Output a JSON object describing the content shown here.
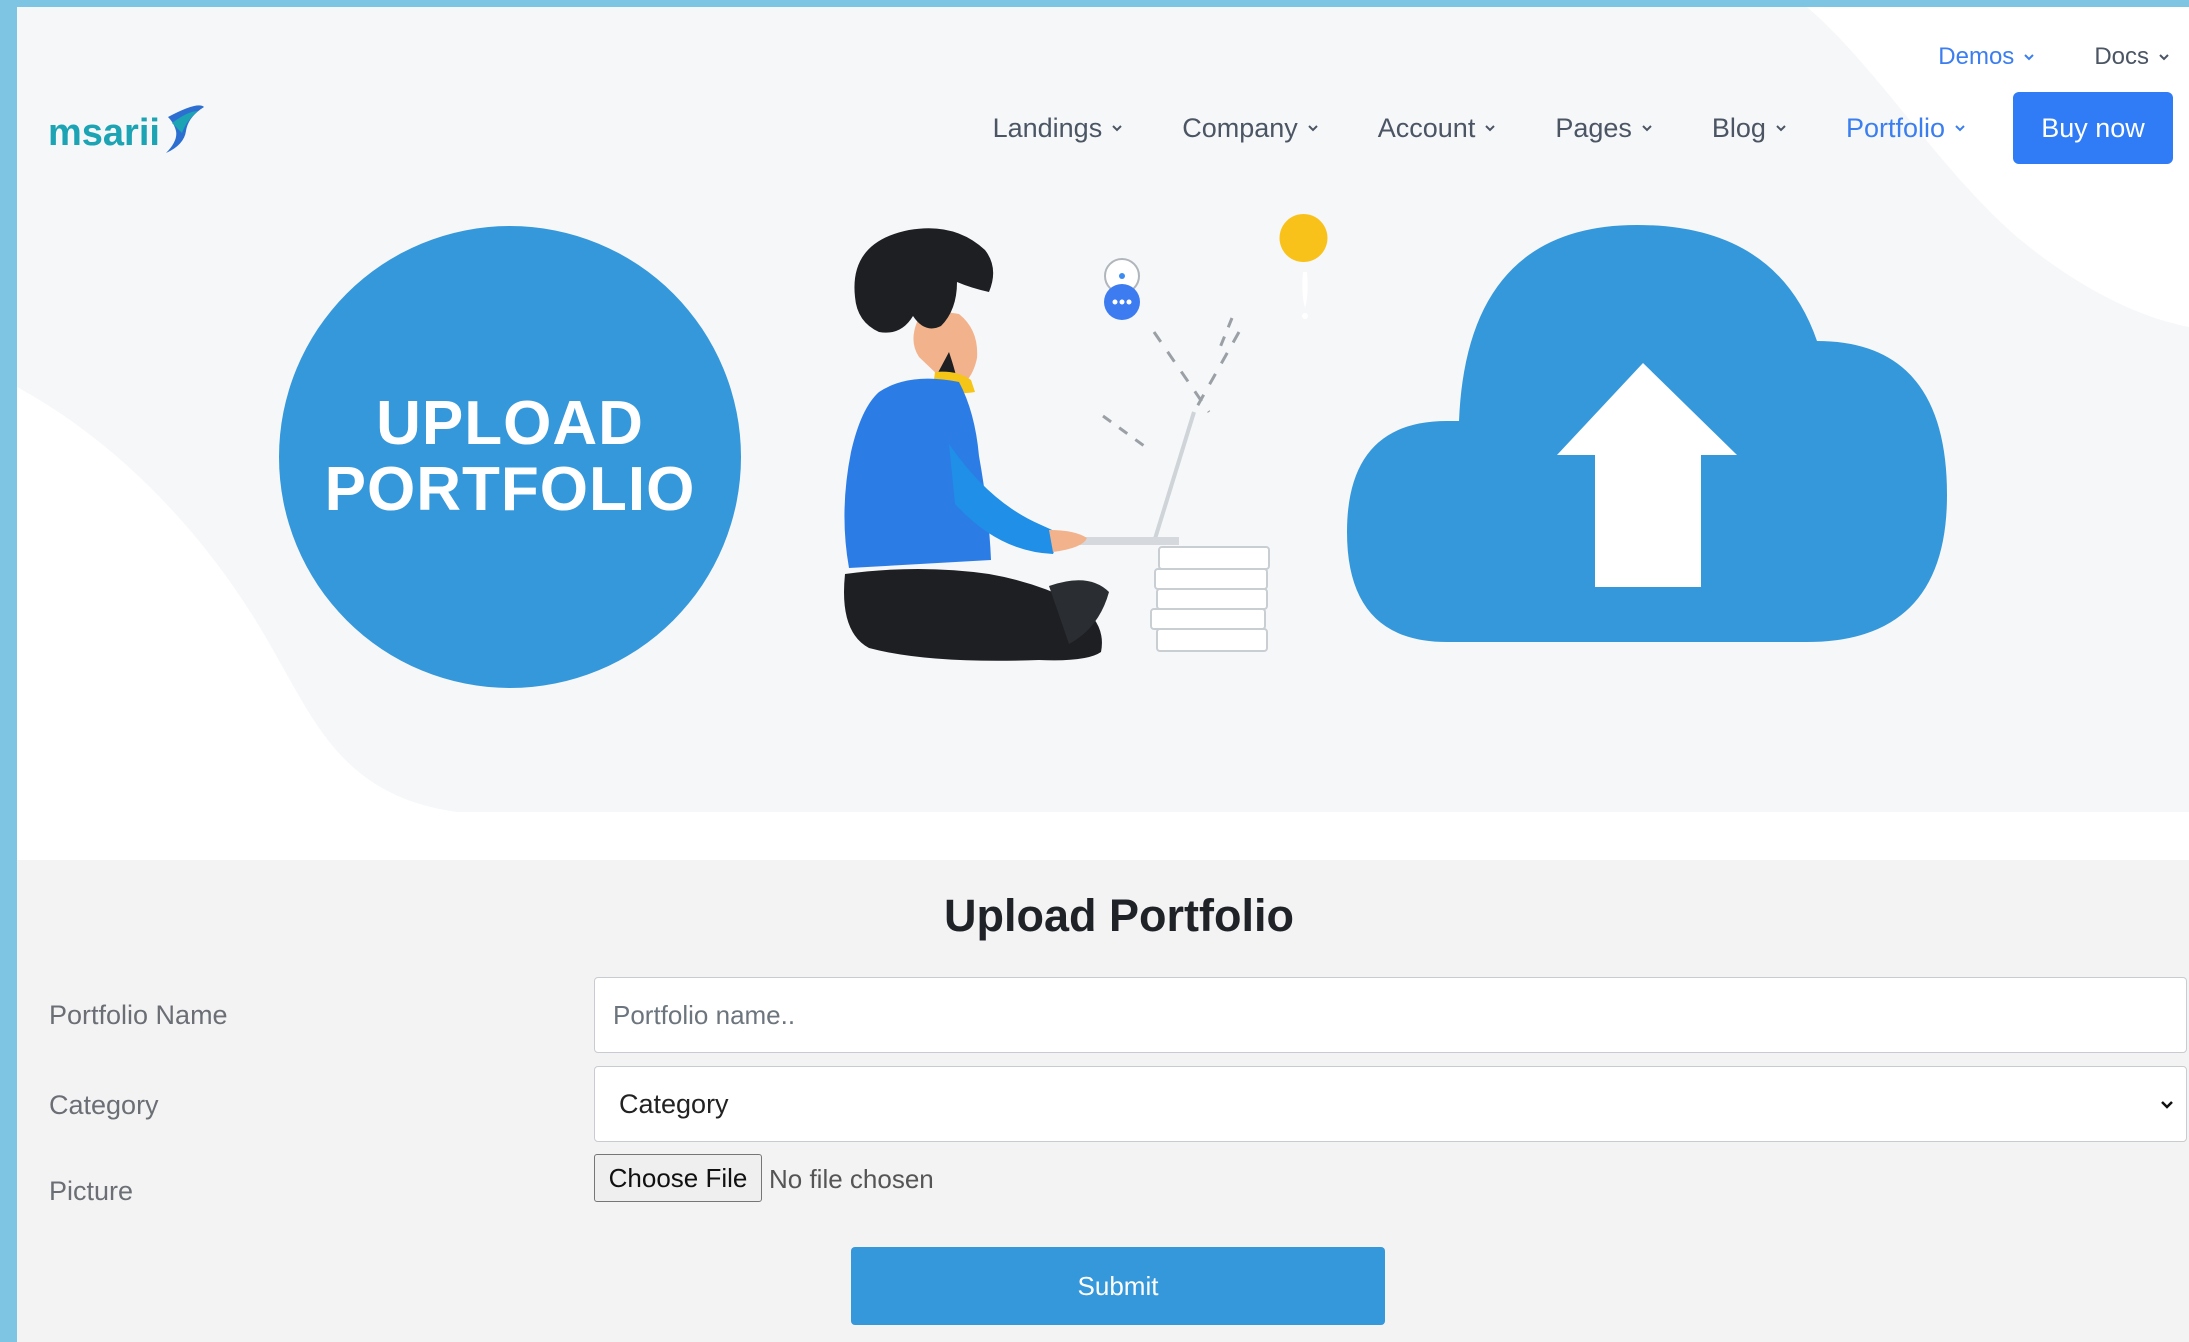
{
  "brand": {
    "logo_text": "msarii"
  },
  "topnav": {
    "demos_label": "Demos",
    "docs_label": "Docs"
  },
  "mainnav": {
    "items": [
      {
        "label": "Landings"
      },
      {
        "label": "Company"
      },
      {
        "label": "Account"
      },
      {
        "label": "Pages"
      },
      {
        "label": "Blog"
      },
      {
        "label": "Portfolio",
        "active": true
      }
    ],
    "buy_label": "Buy now"
  },
  "hero": {
    "badge_line1": "UPLOAD",
    "badge_line2": "PORTFOLIO",
    "illustration_icon": "person-with-laptop",
    "cloud_icon": "cloud-upload-icon"
  },
  "form": {
    "title": "Upload Portfolio",
    "name_label": "Portfolio Name",
    "name_placeholder": "Portfolio name..",
    "category_label": "Category",
    "category_selected": "Category",
    "picture_label": "Picture",
    "file_button": "Choose File",
    "file_status": "No file chosen",
    "submit_label": "Submit"
  },
  "colors": {
    "accent": "#3598db",
    "link_active": "#3b7ef0",
    "buy_button": "#2f7cf6",
    "frame": "#7ec4e3"
  }
}
